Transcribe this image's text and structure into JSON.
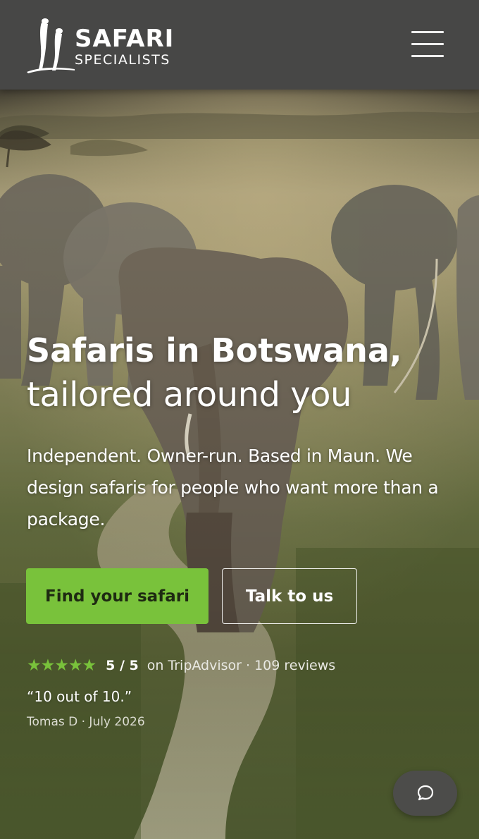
{
  "header": {
    "logo_line1": "SAFARI",
    "logo_line2": "SPECIALISTS",
    "menu_icon": "hamburger-menu-icon"
  },
  "hero": {
    "heading_line1": "Safaris in Botswana,",
    "heading_line2": "tailored around you",
    "intro": "Independent. Owner-run. Based in Maun. We design safaris for people who want more than a package.",
    "primary_cta": "Find your safari",
    "secondary_cta": "Talk to us",
    "rating": {
      "stars": "★★★★★",
      "score": "5 / 5",
      "source": "on TripAdvisor · 109 reviews",
      "value": 5,
      "max": 5
    },
    "testimonial": {
      "quote": "“10 out of 10.”",
      "author": "Tomas D · July 2026"
    }
  },
  "chat": {
    "icon": "chat-bubble-icon"
  },
  "colors": {
    "header_bg": "#474746",
    "accent": "#79c23b",
    "text": "#ffffff"
  }
}
